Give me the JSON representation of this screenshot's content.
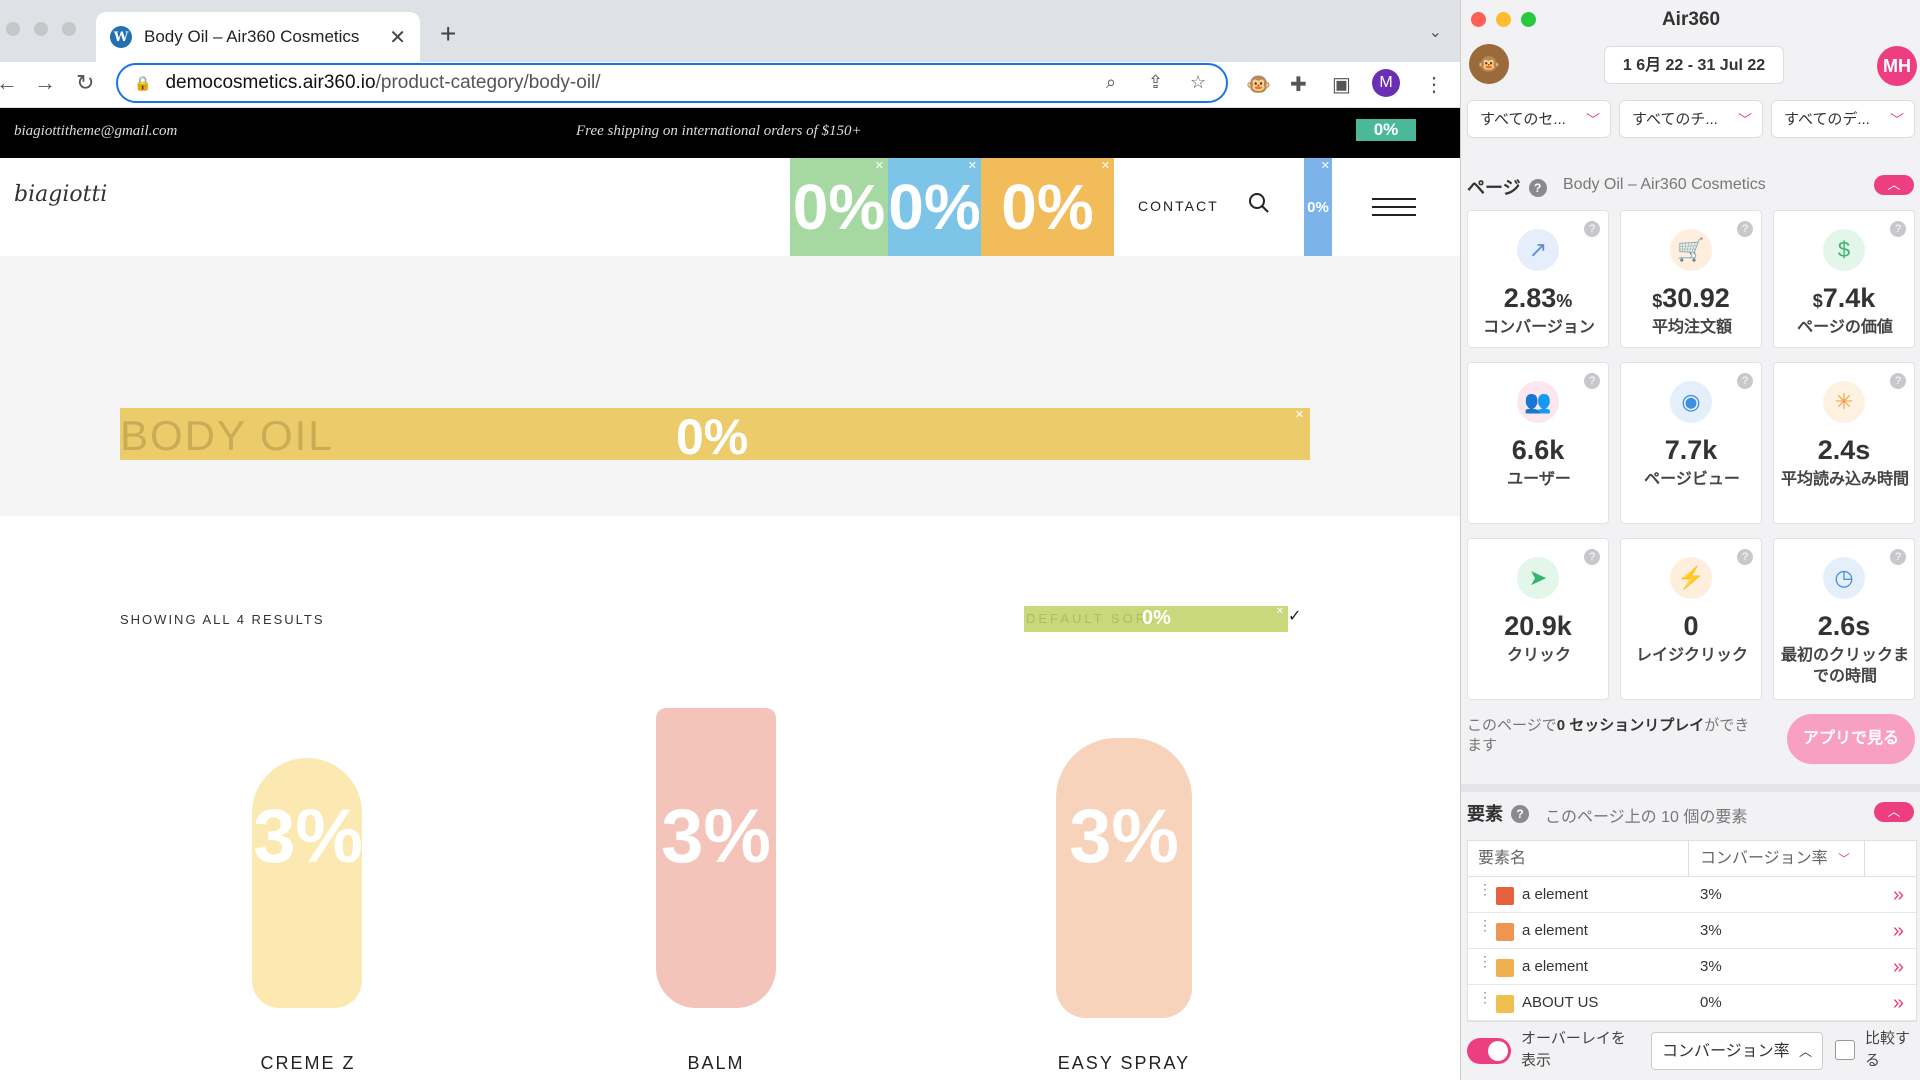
{
  "browser": {
    "tab_title": "Body Oil – Air360 Cosmetics",
    "tab_favicon": "W",
    "url_host": "democosmetics.air360.io",
    "url_path": "/product-category/body-oil/",
    "profile_initial": "M"
  },
  "site": {
    "email": "biagiottitheme@gmail.com",
    "shipping": "Free shipping on international orders of $150+",
    "strip_pct": "0%",
    "logo": "biagiotti",
    "nav_overlays": [
      "0%",
      "0%",
      "0%"
    ],
    "contact": "CONTACT",
    "side_pct": "0%",
    "hero_title": "BODY OIL",
    "hero_pct": "0%",
    "results_text": "SHOWING ALL 4 RESULTS",
    "sort_text": "DEFAULT SORT",
    "sort_pct": "0%",
    "products": [
      {
        "name": "CREME Z",
        "pct": "3%",
        "color": "#efb14f"
      },
      {
        "name": "BALM",
        "pct": "3%",
        "color": "#e4623f"
      },
      {
        "name": "EASY SPRAY",
        "pct": "3%",
        "color": "#ee9552"
      }
    ]
  },
  "panel": {
    "title": "Air360",
    "date_range": "1 6月 22 - 31 Jul 22",
    "user_initials": "MH",
    "filters": [
      "すべてのセ...",
      "すべてのチ...",
      "すべてのデ..."
    ],
    "page_section": "ページ",
    "page_name": "Body Oil – Air360 Cosmetics",
    "metrics": [
      {
        "value": "2.83",
        "unit": "%",
        "label": "コンバージョン",
        "icon": "trend-up-icon",
        "glyph": "↗",
        "color": "#5a8fd6",
        "bg": "#e6eefb"
      },
      {
        "value": "30.92",
        "prefix": "$",
        "label": "平均注文額",
        "icon": "cart-icon",
        "glyph": "🛒",
        "color": "#f08a2c",
        "bg": "#fdeede"
      },
      {
        "value": "7.4k",
        "prefix": "$",
        "label": "ページの価値",
        "icon": "dollar-icon",
        "glyph": "$",
        "color": "#3bb56b",
        "bg": "#e3f6ea"
      },
      {
        "value": "6.6k",
        "label": "ユーザー",
        "icon": "users-icon",
        "glyph": "👥",
        "color": "#e84b7a",
        "bg": "#fde7ee"
      },
      {
        "value": "7.7k",
        "label": "ページビュー",
        "icon": "eye-icon",
        "glyph": "◉",
        "color": "#3e8edb",
        "bg": "#e4effa"
      },
      {
        "value": "2.4s",
        "label": "平均読み込み時間",
        "icon": "loading-icon",
        "glyph": "✳",
        "color": "#f0a040",
        "bg": "#fdf1e2"
      },
      {
        "value": "20.9k",
        "label": "クリック",
        "icon": "cursor-icon",
        "glyph": "➤",
        "color": "#35b56a",
        "bg": "#e3f6ea"
      },
      {
        "value": "0",
        "label": "レイジクリック",
        "icon": "bolt-icon",
        "glyph": "⚡",
        "color": "#f08a2c",
        "bg": "#fdeede"
      },
      {
        "value": "2.6s",
        "label": "最初のクリックまでの時間",
        "icon": "clock-icon",
        "glyph": "◷",
        "color": "#3e8edb",
        "bg": "#e4effa"
      }
    ],
    "replay_pre": "このページで",
    "replay_bold": "0 セッションリプレイ",
    "replay_post": "ができます",
    "app_button": "アプリで見る",
    "elements_section": "要素",
    "elements_sub": "このページ上の 10 個の要素",
    "table_headers": [
      "要素名",
      "コンバージョン率"
    ],
    "rows": [
      {
        "name": "a element",
        "rate": "3%",
        "color": "#e4623f"
      },
      {
        "name": "a element",
        "rate": "3%",
        "color": "#ee9552"
      },
      {
        "name": "a element",
        "rate": "3%",
        "color": "#efb14f"
      },
      {
        "name": "ABOUT US",
        "rate": "0%",
        "color": "#f0c04f"
      }
    ],
    "overlay_label": "オーバーレイを表示",
    "metric_select": "コンバージョン率",
    "compare_label": "比較する"
  }
}
